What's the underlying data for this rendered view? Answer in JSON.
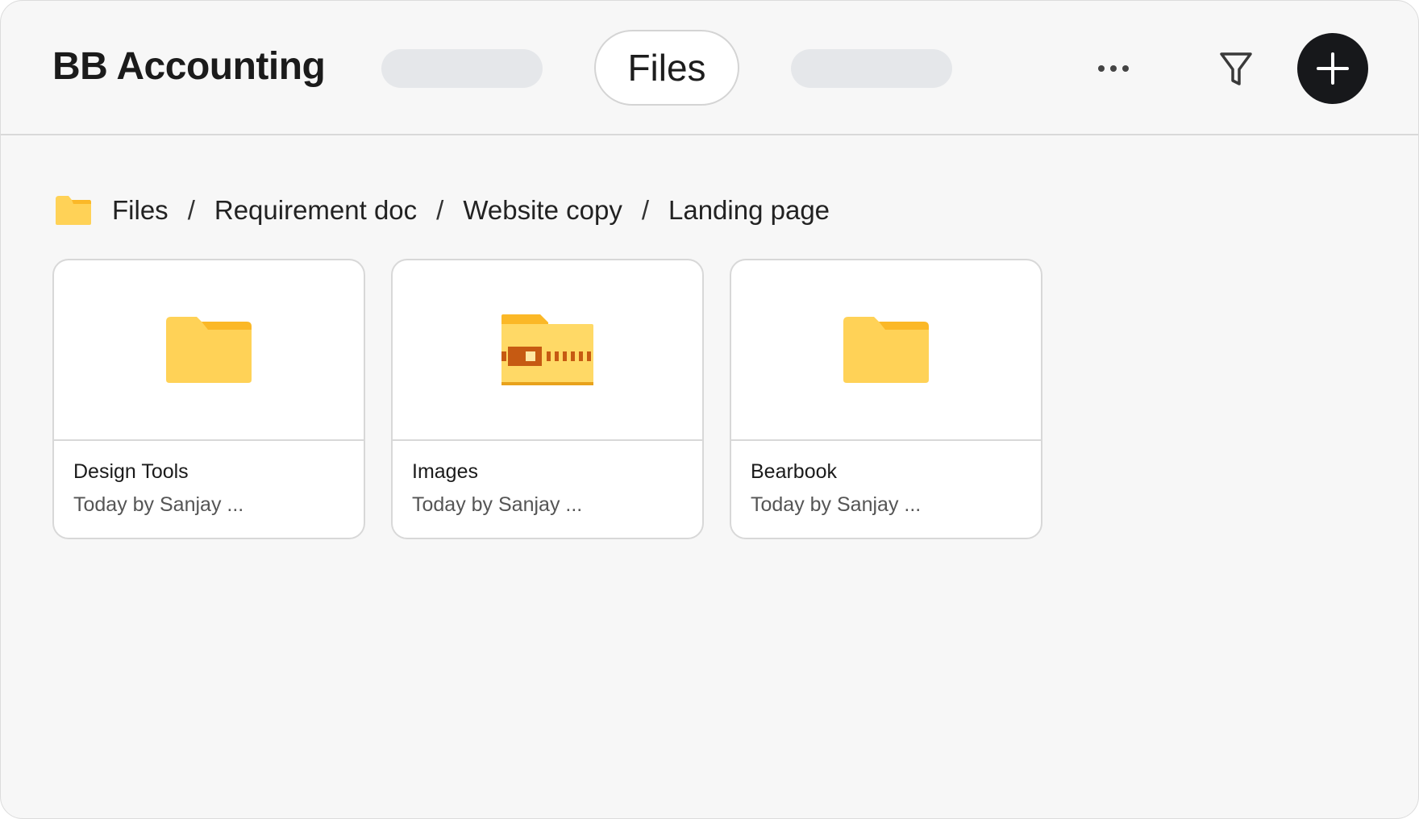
{
  "header": {
    "app_title": "BB Accounting",
    "active_tab_label": "Files",
    "more_icon": "more-horizontal-icon",
    "filter_icon": "filter-icon",
    "add_icon": "plus-icon"
  },
  "breadcrumb": {
    "icon": "folder-icon",
    "items": [
      "Files",
      "Requirement doc",
      "Website copy",
      "Landing page"
    ],
    "separator": "/"
  },
  "files": [
    {
      "name": "Design Tools",
      "meta": "Today by Sanjay ...",
      "icon": "folder-icon"
    },
    {
      "name": "Images",
      "meta": "Today by Sanjay ...",
      "icon": "zip-folder-icon"
    },
    {
      "name": "Bearbook",
      "meta": "Today by Sanjay ...",
      "icon": "folder-icon"
    }
  ],
  "colors": {
    "folder": "#FFD257",
    "folder_tab": "#FBB827",
    "zip_accent": "#C65A12",
    "add_button": "#17181B",
    "background": "#F7F7F7"
  }
}
